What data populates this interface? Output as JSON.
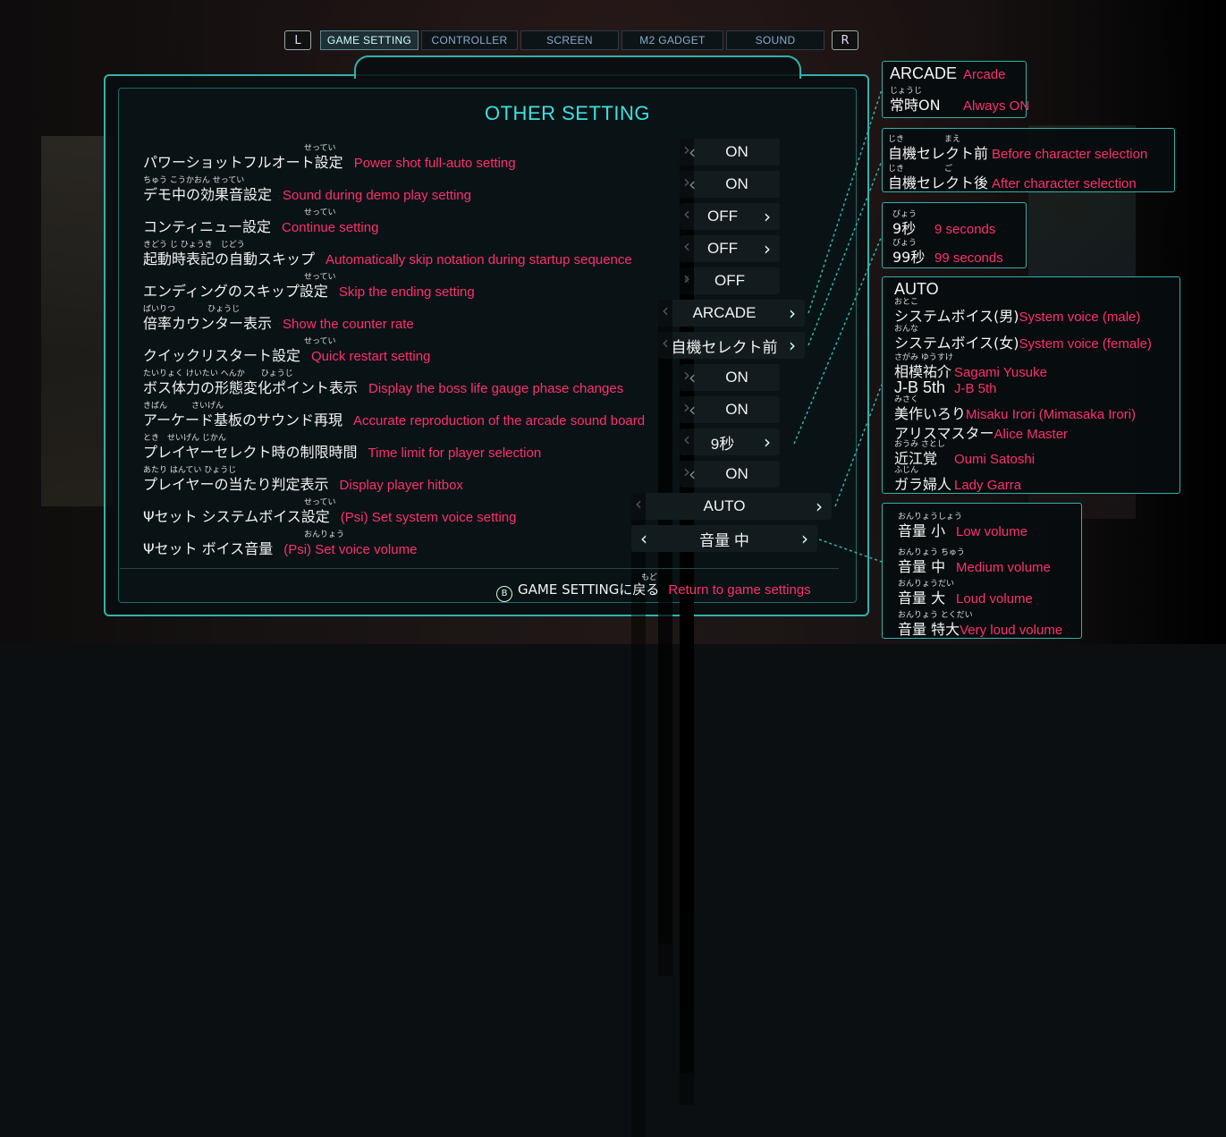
{
  "tabs": {
    "left_shoulder": "L",
    "right_shoulder": "R",
    "items": [
      "GAME SETTING",
      "CONTROLLER",
      "SCREEN",
      "M2 GADGET",
      "SOUND"
    ],
    "active": 0
  },
  "panel": {
    "title": "OTHER SETTING",
    "settings": [
      {
        "jp": "パワーショットフルオート設定",
        "ruby": "せってい",
        "en": "Power shot full-auto setting",
        "value": "ON"
      },
      {
        "jp": "デモ中の効果音設定",
        "ruby": "ちゅう こうかおん せってい",
        "en": "Sound during demo play setting",
        "value": "ON"
      },
      {
        "jp": "コンティニュー設定",
        "ruby": "せってい",
        "en": "Continue setting",
        "value": "OFF"
      },
      {
        "jp": "起動時表記の自動スキップ",
        "ruby": "きどう じ ひょうき　じどう",
        "en": "Automatically skip notation during startup sequence",
        "value": "OFF"
      },
      {
        "jp": "エンディングのスキップ設定",
        "ruby": "せってい",
        "en": "Skip the ending setting",
        "value": "OFF"
      },
      {
        "jp": "倍率カウンター表示",
        "ruby": "ばいりつ　　　　ひょうじ",
        "en": "Show the counter rate",
        "value": "ARCADE"
      },
      {
        "jp": "クイックリスタート設定",
        "ruby": "せってい",
        "en": "Quick restart setting",
        "value": "自機セレクト前"
      },
      {
        "jp": "ボス体力の形態変化ポイント表示",
        "ruby": "たいりょく けいたい へんか　　ひょうじ",
        "en": "Display the boss life gauge phase changes",
        "value": "ON"
      },
      {
        "jp": "アーケード基板のサウンド再現",
        "ruby": "きばん　　　さいげん",
        "en": "Accurate reproduction of the arcade sound board",
        "value": "ON"
      },
      {
        "jp": "プレイヤーセレクト時の制限時間",
        "ruby": "とき　せいげん じかん",
        "en": "Time limit for player selection",
        "value": "9秒"
      },
      {
        "jp": "プレイヤーの当たり判定表示",
        "ruby": "あたり はんてい ひょうじ",
        "en": "Display player hitbox",
        "value": "ON"
      },
      {
        "jp": "Ψセット システムボイス設定",
        "ruby": "せってい",
        "en": "(Psi) Set system voice setting",
        "value": "AUTO"
      },
      {
        "jp": "Ψセット ボイス音量",
        "ruby": "おんりょう",
        "en": "(Psi) Set voice volume",
        "value": "音量 中"
      }
    ],
    "footer": {
      "button": "B",
      "jp": "GAME SETTINGに戻る",
      "ruby": "もど",
      "en": "Return to game settings"
    }
  },
  "sideboxes": {
    "counter": [
      {
        "jp": "ARCADE",
        "ruby": "",
        "en": "Arcade"
      },
      {
        "jp": "常時ON",
        "ruby": "じょうじ",
        "en": "Always ON"
      }
    ],
    "restart": [
      {
        "jp": "自機セレクト前",
        "ruby": "じき　　　　　まえ",
        "en": "Before character selection"
      },
      {
        "jp": "自機セレクト後",
        "ruby": "じき　　　　　ご",
        "en": "After character selection"
      }
    ],
    "timelimit": [
      {
        "jp": "9秒",
        "ruby": "びょう",
        "en": "9 seconds"
      },
      {
        "jp": "99秒",
        "ruby": "びょう",
        "en": "99 seconds"
      }
    ],
    "voice": [
      {
        "jp": "AUTO",
        "ruby": "",
        "en": ""
      },
      {
        "jp": "システムボイス(男)",
        "ruby": "おとこ",
        "en": "System voice (male)"
      },
      {
        "jp": "システムボイス(女)",
        "ruby": "おんな",
        "en": "System voice (female)"
      },
      {
        "jp": "相模祐介",
        "ruby": "さがみ ゆうすけ",
        "en": "Sagami Yusuke"
      },
      {
        "jp": "J-B 5th",
        "ruby": "",
        "en": "J-B 5th"
      },
      {
        "jp": "美作いろり",
        "ruby": "みさく",
        "en": "Misaku Irori (Mimasaka Irori)"
      },
      {
        "jp": "アリスマスター",
        "ruby": "",
        "en": "Alice Master"
      },
      {
        "jp": "近江覚",
        "ruby": "おうみ さとし",
        "en": "Oumi Satoshi"
      },
      {
        "jp": "ガラ婦人",
        "ruby": "ふじん",
        "en": "Lady Garra"
      }
    ],
    "volume": [
      {
        "jp": "音量 小",
        "ruby": "おんりょうしょう",
        "en": "Low volume"
      },
      {
        "jp": "音量 中",
        "ruby": "おんりょう ちゅう",
        "en": "Medium volume"
      },
      {
        "jp": "音量 大",
        "ruby": "おんりょうだい",
        "en": "Loud volume"
      },
      {
        "jp": "音量 特大",
        "ruby": "おんりょう とくだい",
        "en": "Very loud volume"
      }
    ]
  },
  "colors": {
    "accent": "#2fb2ad",
    "title": "#3ee0e0",
    "english": "#ff2f6e"
  }
}
